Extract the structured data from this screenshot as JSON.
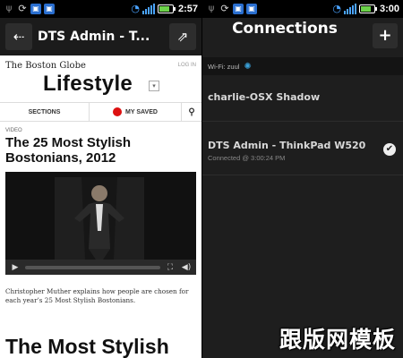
{
  "left": {
    "status_time": "2:57",
    "action_title": "DTS Admin - T...",
    "globe_logo": "The Boston Globe",
    "login": "LOG IN",
    "section_title": "Lifestyle",
    "section_arrow": "▾",
    "tabs": {
      "sections": "SECTIONS",
      "my_saved": "MY SAVED"
    },
    "article": {
      "kicker": "VIDEO",
      "headline": "The 25 Most Stylish Bostonians, 2012",
      "caption": "Christopher Muther explains how people are chosen for each year’s 25 Most Stylish Bostonians.",
      "next_headline": "The Most Stylish"
    }
  },
  "right": {
    "status_time": "3:00",
    "title": "Connections",
    "wifi_label": "Wi-Fi: zuul",
    "connections": [
      {
        "name": "charlie-OSX Shadow",
        "status": "",
        "connected": false
      },
      {
        "name": "DTS Admin - ThinkPad W520",
        "status": "Connected @ 3:00:24 PM",
        "connected": true
      }
    ]
  },
  "watermark": "跟版网模板",
  "icons": {
    "usb": "usb-icon",
    "sync": "sync-icon",
    "wifi": "wifi-icon",
    "battery": "battery-icon",
    "share": "share-icon",
    "external": "open-external-icon",
    "plus": "plus-icon",
    "search": "search-icon",
    "play": "play-icon",
    "fullscreen": "fullscreen-icon",
    "volume": "volume-icon",
    "check": "check-icon"
  },
  "colors": {
    "accent_blue": "#4aa3ff",
    "saved_red": "#dd1111",
    "dark_bg": "#1e1e1e"
  }
}
